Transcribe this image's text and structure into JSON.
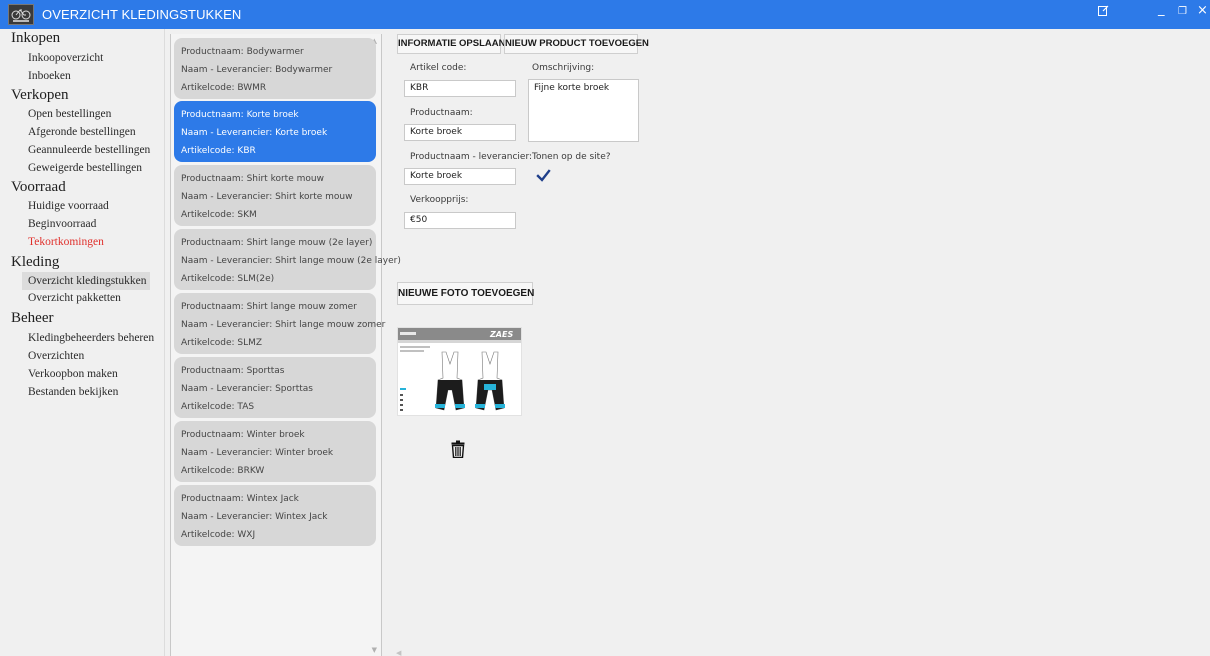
{
  "window": {
    "title": "OVERZICHT KLEDINGSTUKKEN",
    "controls": {
      "minimize": "_",
      "restore": "❐",
      "close": "×"
    }
  },
  "sidebar": {
    "sections": [
      {
        "label": "Inkopen",
        "items": [
          "Inkoopoverzicht",
          "Inboeken"
        ]
      },
      {
        "label": "Verkopen",
        "items": [
          "Open bestellingen",
          "Afgeronde bestellingen",
          "Geannuleerde bestellingen",
          "Geweigerde bestellingen"
        ]
      },
      {
        "label": "Voorraad",
        "items": [
          "Huidige voorraad",
          "Beginvoorraad",
          "Tekortkomingen"
        ]
      },
      {
        "label": "Kleding",
        "items": [
          "Overzicht kledingstukken",
          "Overzicht pakketten"
        ]
      },
      {
        "label": "Beheer",
        "items": [
          "Kledingbeheerders beheren",
          "Overzichten",
          "Verkoopbon maken",
          "Bestanden bekijken"
        ]
      }
    ],
    "active_item": "Overzicht kledingstukken",
    "alert_item": "Tekortkomingen"
  },
  "product_list": {
    "selected_index": 1,
    "items": [
      {
        "productnaam": "Productnaam:  Bodywarmer",
        "leverancier": "Naam - Leverancier:  Bodywarmer",
        "artikelcode": "Artikelcode:  BWMR"
      },
      {
        "productnaam": "Productnaam:  Korte broek",
        "leverancier": "Naam - Leverancier:  Korte broek",
        "artikelcode": "Artikelcode:  KBR"
      },
      {
        "productnaam": "Productnaam:  Shirt korte mouw",
        "leverancier": "Naam - Leverancier:  Shirt korte mouw",
        "artikelcode": "Artikelcode:  SKM"
      },
      {
        "productnaam": "Productnaam:  Shirt lange mouw (2e layer)",
        "leverancier": "Naam - Leverancier:  Shirt lange mouw (2e layer)",
        "artikelcode": "Artikelcode:  SLM(2e)"
      },
      {
        "productnaam": "Productnaam:  Shirt lange mouw zomer",
        "leverancier": "Naam - Leverancier:  Shirt lange mouw zomer",
        "artikelcode": "Artikelcode:  SLMZ"
      },
      {
        "productnaam": "Productnaam:  Sporttas",
        "leverancier": "Naam - Leverancier:  Sporttas",
        "artikelcode": "Artikelcode:  TAS"
      },
      {
        "productnaam": "Productnaam:  Winter broek",
        "leverancier": "Naam - Leverancier:  Winter broek",
        "artikelcode": "Artikelcode:  BRKW"
      },
      {
        "productnaam": "Productnaam:  Wintex Jack",
        "leverancier": "Naam - Leverancier:  Wintex Jack",
        "artikelcode": "Artikelcode:  WXJ"
      }
    ]
  },
  "toolbar": {
    "save_label": "INFORMATIE OPSLAAN",
    "new_product_label": "NIEUW PRODUCT TOEVOEGEN"
  },
  "form": {
    "artikelcode_label": "Artikel code:",
    "artikelcode_value": "KBR",
    "productnaam_label": "Productnaam:",
    "productnaam_value": "Korte broek",
    "leverancier_label": "Productnaam - leverancier:",
    "leverancier_value": "Korte broek",
    "verkoopprijs_label": "Verkoopprijs:",
    "verkoopprijs_value": "€50",
    "omschrijving_label": "Omschrijving:",
    "omschrijving_value": "Fijne korte broek",
    "tonen_label": "Tonen op de site?",
    "tonen_checked": true
  },
  "photos": {
    "add_label": "NIEUWE FOTO TOEVOEGEN",
    "brand_text": "ZAES"
  },
  "colors": {
    "accent": "#2d7ae8",
    "alert": "#e0302c",
    "check": "#1f3f8a"
  }
}
